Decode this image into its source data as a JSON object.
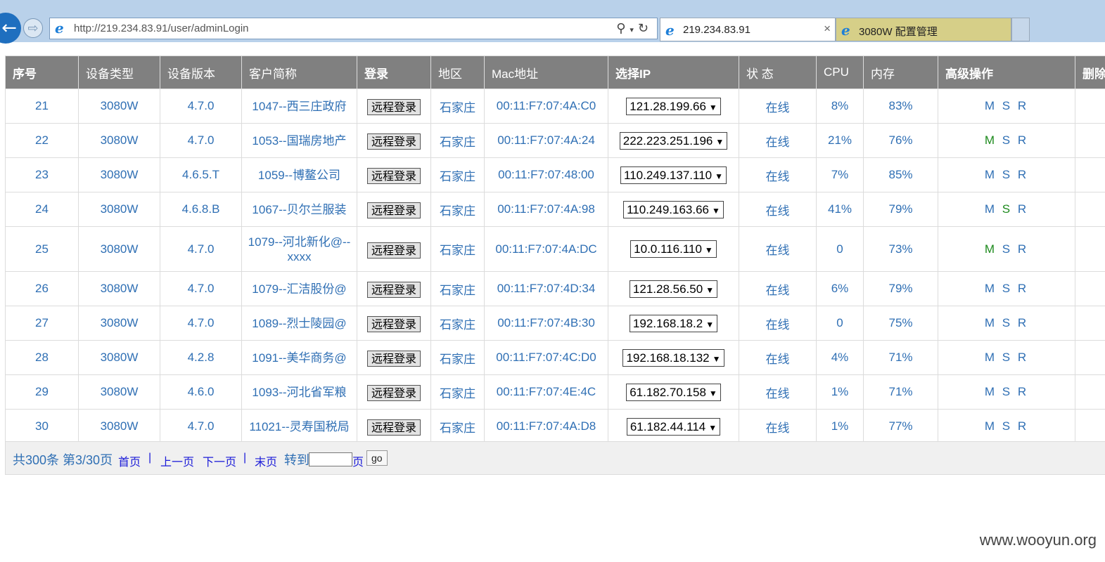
{
  "browser": {
    "url": "http://219.234.83.91/user/adminLogin",
    "active_tab_title": "219.234.83.91",
    "inactive_tab_title": "3080W 配置管理",
    "close_glyph": "×",
    "icons": {
      "back": "back-arrow-icon",
      "forward": "forward-arrow-icon",
      "search": "search-icon",
      "refresh": "refresh-icon",
      "ie": "ie-logo-icon"
    }
  },
  "table": {
    "headers": [
      "序号",
      "设备类型",
      "设备版本",
      "客户简称",
      "登录",
      "地区",
      "Mac地址",
      "选择IP",
      "状 态",
      "CPU",
      "内存",
      "高级操作",
      "删除"
    ],
    "login_button_label": "远程登录",
    "ops": {
      "m": "M",
      "s": "S",
      "r": "R"
    },
    "rows": [
      {
        "id": "21",
        "type": "3080W",
        "version": "4.7.0",
        "customer": "1047--西三庄政府",
        "region": "石家庄",
        "mac": "00:11:F7:07:4A:C0",
        "ip": "121.28.199.66",
        "status": "在线",
        "cpu": "8%",
        "mem": "83%"
      },
      {
        "id": "22",
        "type": "3080W",
        "version": "4.7.0",
        "customer": "1053--国瑞房地产",
        "region": "石家庄",
        "mac": "00:11:F7:07:4A:24",
        "ip": "222.223.251.196",
        "status": "在线",
        "cpu": "21%",
        "mem": "76%",
        "green": "m"
      },
      {
        "id": "23",
        "type": "3080W",
        "version": "4.6.5.T",
        "customer": "1059--博鳌公司",
        "region": "石家庄",
        "mac": "00:11:F7:07:48:00",
        "ip": "110.249.137.110",
        "status": "在线",
        "cpu": "7%",
        "mem": "85%"
      },
      {
        "id": "24",
        "type": "3080W",
        "version": "4.6.8.B",
        "customer": "1067--贝尔兰服装",
        "region": "石家庄",
        "mac": "00:11:F7:07:4A:98",
        "ip": "110.249.163.66",
        "status": "在线",
        "cpu": "41%",
        "mem": "79%",
        "green": "s"
      },
      {
        "id": "25",
        "type": "3080W",
        "version": "4.7.0",
        "customer": "1079--河北新化@--xxxx",
        "region": "石家庄",
        "mac": "00:11:F7:07:4A:DC",
        "ip": "10.0.116.110",
        "status": "在线",
        "cpu": "0",
        "mem": "73%",
        "green": "m"
      },
      {
        "id": "26",
        "type": "3080W",
        "version": "4.7.0",
        "customer": "1079--汇洁股份@",
        "region": "石家庄",
        "mac": "00:11:F7:07:4D:34",
        "ip": "121.28.56.50",
        "status": "在线",
        "cpu": "6%",
        "mem": "79%"
      },
      {
        "id": "27",
        "type": "3080W",
        "version": "4.7.0",
        "customer": "1089--烈士陵园@",
        "region": "石家庄",
        "mac": "00:11:F7:07:4B:30",
        "ip": "192.168.18.2",
        "status": "在线",
        "cpu": "0",
        "mem": "75%"
      },
      {
        "id": "28",
        "type": "3080W",
        "version": "4.2.8",
        "customer": "1091--美华商务@",
        "region": "石家庄",
        "mac": "00:11:F7:07:4C:D0",
        "ip": "192.168.18.132",
        "status": "在线",
        "cpu": "4%",
        "mem": "71%"
      },
      {
        "id": "29",
        "type": "3080W",
        "version": "4.6.0",
        "customer": "1093--河北省军粮",
        "region": "石家庄",
        "mac": "00:11:F7:07:4E:4C",
        "ip": "61.182.70.158",
        "status": "在线",
        "cpu": "1%",
        "mem": "71%"
      },
      {
        "id": "30",
        "type": "3080W",
        "version": "4.7.0",
        "customer": "11021--灵寿国税局",
        "region": "石家庄",
        "mac": "00:11:F7:07:4A:D8",
        "ip": "61.182.44.114",
        "status": "在线",
        "cpu": "1%",
        "mem": "77%"
      }
    ]
  },
  "pager": {
    "summary": "共300条 第3/30页",
    "first": "首页",
    "prev": "上一页",
    "next": "下一页",
    "last": "末页",
    "separator": "|",
    "goto_label": "转到",
    "page_unit": "页",
    "go_label": "go"
  },
  "watermark": "www.wooyun.org"
}
